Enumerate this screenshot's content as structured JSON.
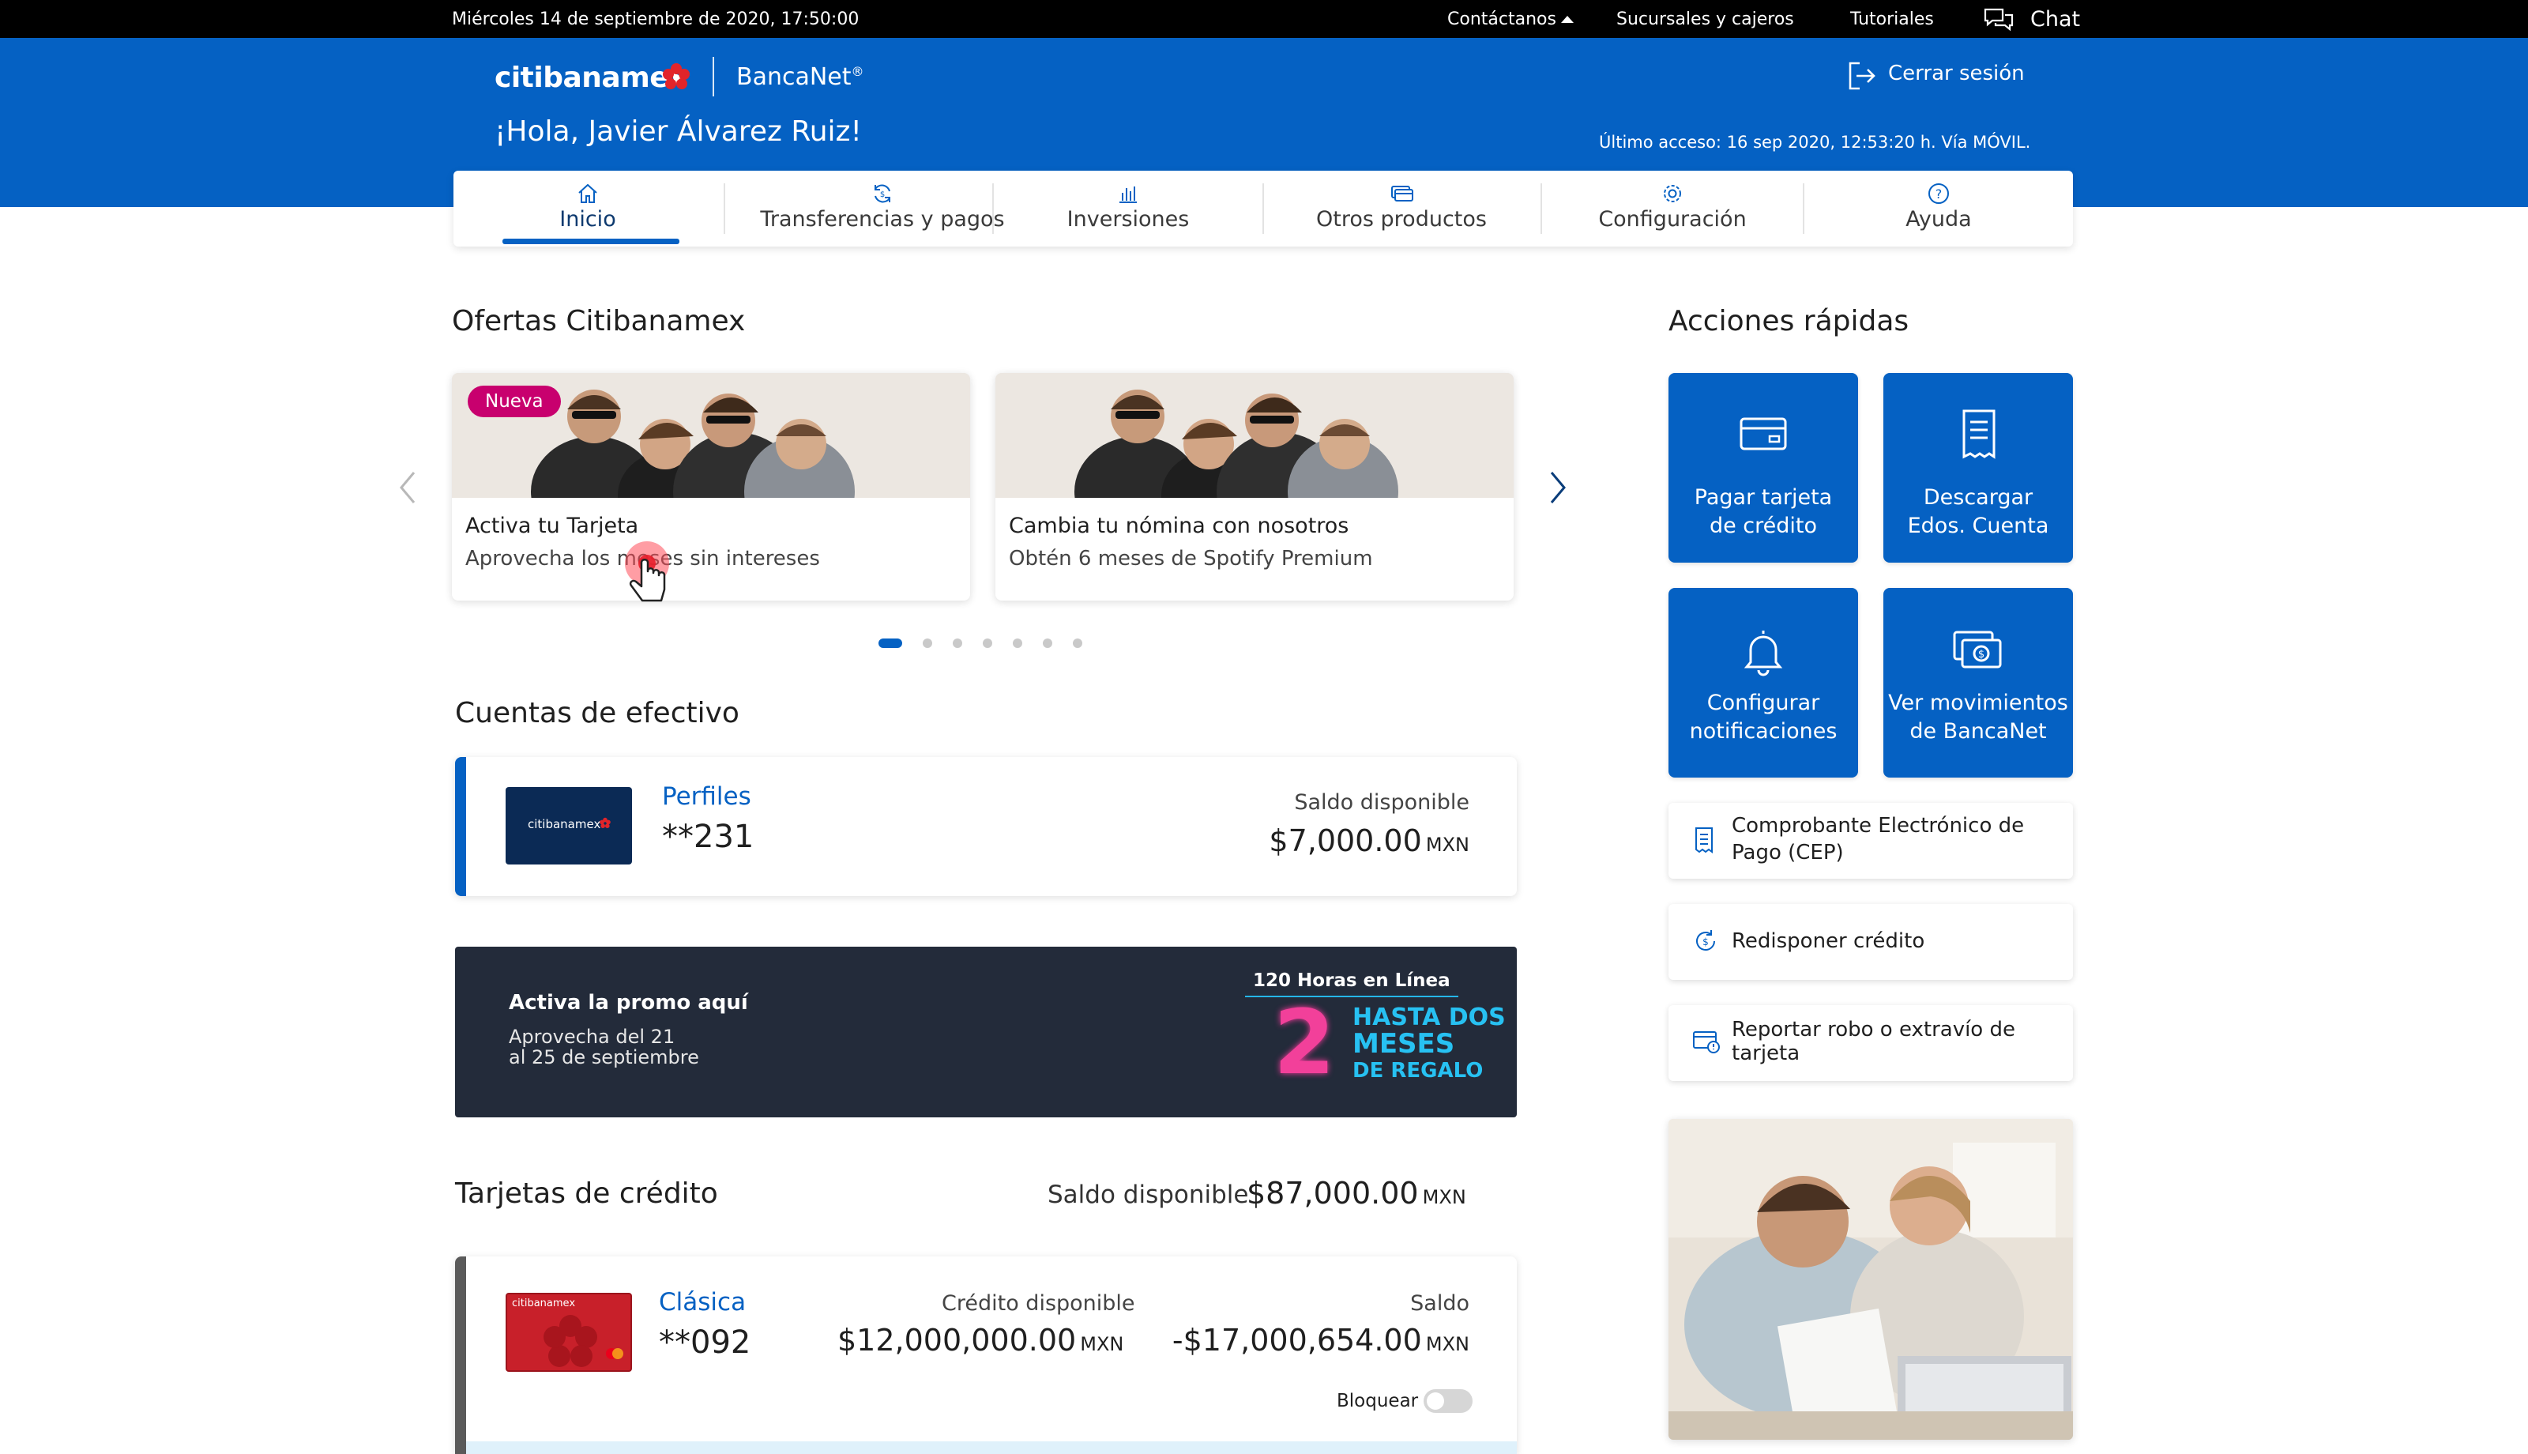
{
  "topbar": {
    "datetime": "Miércoles 14 de septiembre de 2020, 17:50:00",
    "contact": "Contáctanos",
    "branches": "Sucursales y cajeros",
    "tutorials": "Tutoriales",
    "chat": "Chat"
  },
  "header": {
    "logo": "citibanamex",
    "product": "BancaNet",
    "greeting": "¡Hola, Javier Álvarez Ruiz!",
    "logout": "Cerrar sesión",
    "last_access": "Último acceso: 16 sep 2020, 12:53:20 h. Vía MÓVIL."
  },
  "nav": {
    "tabs": [
      {
        "label": "Inicio",
        "icon": "home-icon"
      },
      {
        "label": "Transferencias y pagos",
        "icon": "transfer-icon"
      },
      {
        "label": "Inversiones",
        "icon": "bar-chart-icon"
      },
      {
        "label": "Otros productos",
        "icon": "products-icon"
      },
      {
        "label": "Configuración",
        "icon": "gear-icon"
      },
      {
        "label": "Ayuda",
        "icon": "help-icon"
      }
    ]
  },
  "offers": {
    "heading": "Ofertas Citibanamex",
    "items": [
      {
        "badge": "Nueva",
        "title": "Activa tu Tarjeta",
        "subtitle": "Aprovecha los meses sin intereses"
      },
      {
        "title": "Cambia tu nómina con nosotros",
        "subtitle": "Obtén 6 meses de Spotify Premium"
      }
    ],
    "dots_total": 7,
    "dots_active": 1
  },
  "cash": {
    "heading": "Cuentas de efectivo",
    "account": {
      "card_logo": "citibanamex",
      "name": "Perfiles",
      "number": "**231",
      "balance_label": "Saldo disponible",
      "balance": "$7,000.00",
      "currency": "MXN"
    }
  },
  "promo": {
    "title": "Activa la promo aquí",
    "line1": "Aprovecha del 21",
    "line2": "al 25 de septiembre",
    "badge_top": "120 Horas en Línea",
    "badge_number": "2",
    "badge_line1": "HASTA DOS",
    "badge_line2": "MESES",
    "badge_line3": "DE REGALO"
  },
  "credit": {
    "heading": "Tarjetas de crédito",
    "available_label": "Saldo disponible",
    "available": "$87,000.00",
    "currency": "MXN",
    "card": {
      "card_logo": "citibanamex",
      "name": "Clásica",
      "number": "**092",
      "credit_label": "Crédito disponible",
      "credit": "$12,000,000.00",
      "balance_label": "Saldo",
      "balance": "-$17,000,654.00",
      "currency": "MXN",
      "lock_label": "Bloquear"
    }
  },
  "quick_actions": {
    "heading": "Acciones rápidas",
    "tiles": [
      {
        "line1": "Pagar tarjeta",
        "line2": "de crédito",
        "icon": "credit-card-icon"
      },
      {
        "line1": "Descargar",
        "line2": "Edos. Cuenta",
        "icon": "document-icon"
      },
      {
        "line1": "Configurar",
        "line2": "notificaciones",
        "icon": "bell-icon"
      },
      {
        "line1": "Ver movimientos",
        "line2": "de BancaNet",
        "icon": "money-icon"
      }
    ],
    "list": [
      {
        "line1": "Comprobante Electrónico de",
        "line2": "Pago (CEP)",
        "icon": "receipt-icon"
      },
      {
        "line1": "Redisponer crédito",
        "icon": "refresh-credit-icon"
      },
      {
        "line1": "Reportar robo o extravío de",
        "line2": "tarjeta",
        "icon": "report-card-icon"
      }
    ]
  },
  "colors": {
    "brand_blue": "#0561c3",
    "badge_pink": "#c8006e",
    "promo_bg": "#232b3a",
    "card_red": "#c8202a"
  }
}
